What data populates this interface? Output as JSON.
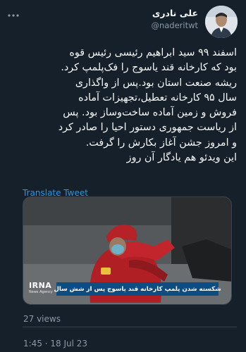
{
  "author": {
    "display_name": "علی نادری",
    "handle": "@naderitwt"
  },
  "tweet": {
    "lines": [
      "اسفند ۹۹ سید ابراهیم رئیسی رئیس قوه",
      "بود که کارخانه قند یاسوج را فک‌پلمپ کرد.",
      "ریشه صنعت استان بود.پس از واگذاری",
      "سال ۹۵ کارخانه تعطیل،تجهیزات آماده",
      "فروش و زمین آماده ساخت‌وساز بود. پس",
      "از ریاست جمهوری دستور احیا را صادر کرد",
      "و امروز جشن آغاز بکارش را گرفت.",
      "این ویدئو هم یادگار آن روز"
    ],
    "translate_label": "Translate Tweet"
  },
  "media": {
    "logo_text": "IRNA",
    "logo_subtext": "News Agency",
    "caption": "شکسته شدن پلمپ کارخانه قند یاسوج پس از شش سال"
  },
  "stats": {
    "views": "27 views",
    "timestamp": "1:45 · 18 Jul 23"
  },
  "colors": {
    "background": "#15202b",
    "text": "#f7f9f9",
    "secondary": "#8b98a5",
    "link": "#1d9bf0",
    "caption_bar": "#0f4c81"
  },
  "icons": {
    "more": "more-horizontal-icon"
  }
}
